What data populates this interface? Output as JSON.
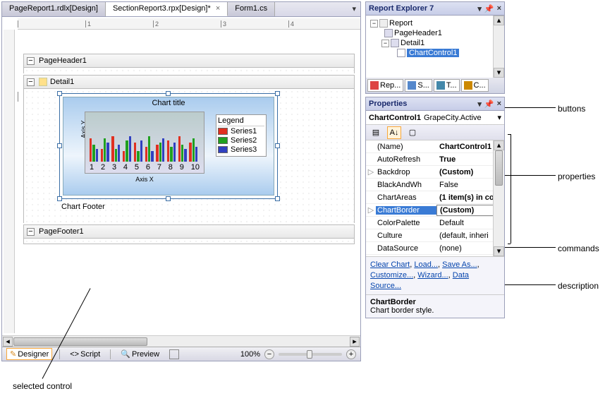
{
  "tabs": {
    "items": [
      {
        "label": "PageReport1.rdlx[Design]",
        "active": false,
        "closable": false
      },
      {
        "label": "SectionReport3.rpx[Design]*",
        "active": true,
        "closable": true
      },
      {
        "label": "Form1.cs",
        "active": false,
        "closable": false
      }
    ]
  },
  "ruler": {
    "marks": [
      "1",
      "2",
      "3",
      "4"
    ]
  },
  "sections": {
    "pageHeader": "PageHeader1",
    "detail": "Detail1",
    "pageFooter": "PageFooter1"
  },
  "chart": {
    "title": "Chart title",
    "footer": "Chart Footer",
    "xlabel": "Axis X",
    "ylabel": "Axis Y",
    "legendTitle": "Legend",
    "series": [
      {
        "name": "Series1",
        "color": "#e03020"
      },
      {
        "name": "Series2",
        "color": "#20a020"
      },
      {
        "name": "Series3",
        "color": "#3040c0"
      }
    ],
    "xticks": [
      "1",
      "2",
      "3",
      "4",
      "5",
      "6",
      "7",
      "8",
      "9",
      "10"
    ]
  },
  "chart_data": {
    "type": "bar",
    "title": "Chart title",
    "xlabel": "Axis X",
    "ylabel": "Axis Y",
    "categories": [
      1,
      2,
      3,
      4,
      5,
      6,
      7,
      8,
      9,
      10
    ],
    "series": [
      {
        "name": "Series1",
        "color": "#e03020",
        "values": [
          55,
          30,
          60,
          25,
          45,
          35,
          40,
          50,
          60,
          45
        ]
      },
      {
        "name": "Series2",
        "color": "#20a020",
        "values": [
          40,
          55,
          30,
          50,
          25,
          60,
          45,
          35,
          40,
          55
        ]
      },
      {
        "name": "Series3",
        "color": "#3040c0",
        "values": [
          30,
          45,
          40,
          60,
          50,
          25,
          55,
          45,
          30,
          35
        ]
      }
    ],
    "legend": {
      "position": "right",
      "title": "Legend"
    }
  },
  "bottomBar": {
    "designer": "Designer",
    "script": "Script",
    "preview": "Preview",
    "zoom": "100%"
  },
  "explorer": {
    "title": "Report Explorer 7",
    "nodes": {
      "root": "Report",
      "pageHeader": "PageHeader1",
      "detail": "Detail1",
      "selected": "ChartControl1"
    },
    "miniTabs": [
      "Rep...",
      "S...",
      "T...",
      "C..."
    ]
  },
  "properties": {
    "title": "Properties",
    "object": "ChartControl1",
    "objectType": "GrapeCity.Active",
    "rows": [
      {
        "name": "(Name)",
        "value": "ChartControl1",
        "bold": true
      },
      {
        "name": "AutoRefresh",
        "value": "True",
        "bold": true
      },
      {
        "name": "Backdrop",
        "value": "(Custom)",
        "bold": true,
        "expandable": true
      },
      {
        "name": "BlackAndWh",
        "value": "False",
        "bold": false
      },
      {
        "name": "ChartAreas",
        "value": "(1 item(s) in co",
        "bold": true
      },
      {
        "name": "ChartBorder",
        "value": "(Custom)",
        "bold": true,
        "selected": true,
        "expandable": true
      },
      {
        "name": "ColorPalette",
        "value": "Default",
        "bold": false
      },
      {
        "name": "Culture",
        "value": "(default, inheri",
        "bold": false
      },
      {
        "name": "DataSource",
        "value": "(none)",
        "bold": false
      }
    ],
    "commands": [
      "Clear Chart",
      "Load...",
      "Save As...",
      "Customize...",
      "Wizard...",
      "Data Source..."
    ],
    "descTitle": "ChartBorder",
    "descText": "Chart border style."
  },
  "annotations": {
    "buttons": "buttons",
    "properties": "properties",
    "commands": "commands",
    "description": "description",
    "selected": "selected control"
  }
}
